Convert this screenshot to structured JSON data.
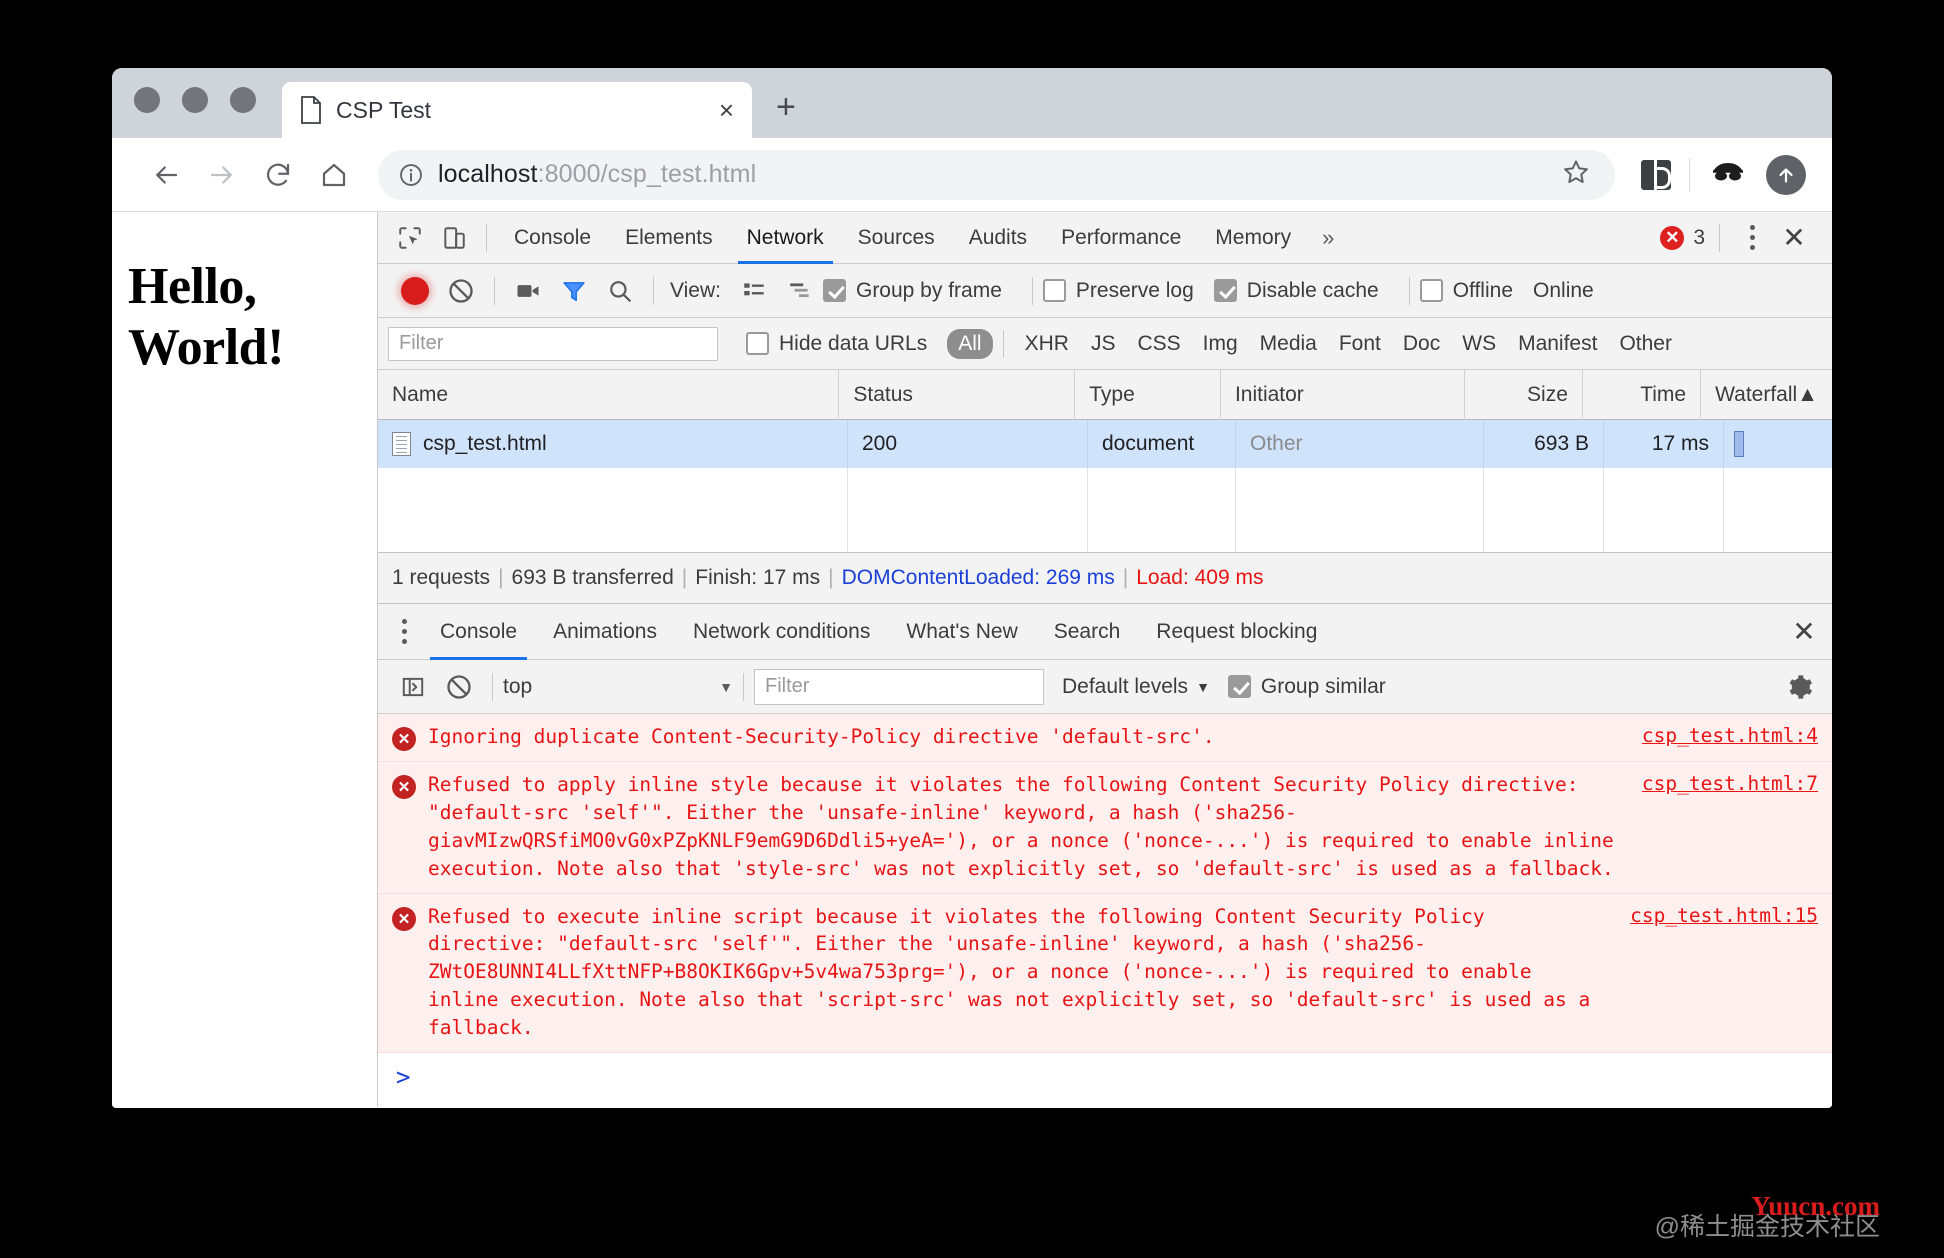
{
  "browser": {
    "tab": {
      "title": "CSP Test",
      "close_label": "×",
      "icon": "document-icon"
    },
    "new_tab_label": "+",
    "nav": {
      "back": "←",
      "forward": "→",
      "reload": "⟳",
      "home": "⌂"
    },
    "omnibox": {
      "host": "localhost",
      "rest": ":8000/csp_test.html",
      "info_icon": "info-icon",
      "star_icon": "star-icon"
    },
    "toolbar_icons": [
      "extension-icon",
      "profile-avatar-icon",
      "upload-icon"
    ]
  },
  "page": {
    "heading_line1": "Hello,",
    "heading_line2": "World!"
  },
  "devtools": {
    "tabs": [
      {
        "label": "Console",
        "active": false
      },
      {
        "label": "Elements",
        "active": false
      },
      {
        "label": "Network",
        "active": true
      },
      {
        "label": "Sources",
        "active": false
      },
      {
        "label": "Audits",
        "active": false
      },
      {
        "label": "Performance",
        "active": false
      },
      {
        "label": "Memory",
        "active": false
      }
    ],
    "more_label": "»",
    "error_count": "3",
    "close_label": "✕"
  },
  "network_toolbar": {
    "view_label": "View:",
    "checkboxes": [
      {
        "label": "Group by frame",
        "checked": true
      },
      {
        "label": "Preserve log",
        "checked": false
      },
      {
        "label": "Disable cache",
        "checked": true
      },
      {
        "label": "Offline",
        "checked": false
      }
    ],
    "online_label": "Online"
  },
  "filter_bar": {
    "filter_placeholder": "Filter",
    "hide_data_urls_label": "Hide data URLs",
    "hide_data_urls_checked": false,
    "types": [
      "All",
      "XHR",
      "JS",
      "CSS",
      "Img",
      "Media",
      "Font",
      "Doc",
      "WS",
      "Manifest",
      "Other"
    ],
    "selected_type": "All"
  },
  "requests_table": {
    "columns": [
      "Name",
      "Status",
      "Type",
      "Initiator",
      "Size",
      "Time",
      "Waterfall"
    ],
    "sort_indicator": "▲",
    "rows": [
      {
        "name": "csp_test.html",
        "status": "200",
        "type": "document",
        "initiator": "Other",
        "size": "693 B",
        "time": "17 ms"
      }
    ]
  },
  "summary": {
    "requests": "1 requests",
    "transferred": "693 B transferred",
    "finish": "Finish: 17 ms",
    "domcontentloaded": "DOMContentLoaded: 269 ms",
    "load": "Load: 409 ms",
    "separator": "|"
  },
  "drawer": {
    "tabs": [
      {
        "label": "Console",
        "active": true
      },
      {
        "label": "Animations",
        "active": false
      },
      {
        "label": "Network conditions",
        "active": false
      },
      {
        "label": "What's New",
        "active": false
      },
      {
        "label": "Search",
        "active": false
      },
      {
        "label": "Request blocking",
        "active": false
      }
    ],
    "close_label": "✕"
  },
  "console_toolbar": {
    "context": "top",
    "caret": "▼",
    "filter_placeholder": "Filter",
    "levels_label": "Default levels",
    "levels_caret": "▼",
    "group_similar_label": "Group similar",
    "group_similar_checked": true
  },
  "console_messages": [
    {
      "icon": "error-icon",
      "text": "Ignoring duplicate Content-Security-Policy directive 'default-src'.",
      "source": "csp_test.html:4"
    },
    {
      "icon": "error-icon",
      "text": "Refused to apply inline style because it violates the following Content Security Policy directive: \"default-src 'self'\". Either the 'unsafe-inline' keyword, a hash ('sha256-giavMIzwQRSfiMO0vG0xPZpKNLF9emG9D6Ddli5+yeA='), or a nonce ('nonce-...') is required to enable inline execution. Note also that 'style-src' was not explicitly set, so 'default-src' is used as a fallback.",
      "source": "csp_test.html:7"
    },
    {
      "icon": "error-icon",
      "text": "Refused to execute inline script because it violates the following Content Security Policy directive: \"default-src 'self'\". Either the 'unsafe-inline' keyword, a hash ('sha256-ZWtOE8UNNI4LLfXttNFP+B8OKIK6Gpv+5v4wa753prg='), or a nonce ('nonce-...') is required to enable inline execution. Note also that 'script-src' was not explicitly set, so 'default-src' is used as a fallback.",
      "source": "csp_test.html:15"
    }
  ],
  "console_prompt": ">",
  "watermark": {
    "red": "Yuucn.com",
    "gray": "@稀土掘金技术社区"
  },
  "colors": {
    "accent_blue": "#1a73e8",
    "error_red": "#e81313",
    "record_red": "#d81b1b",
    "row_select": "#cfe3fb"
  }
}
